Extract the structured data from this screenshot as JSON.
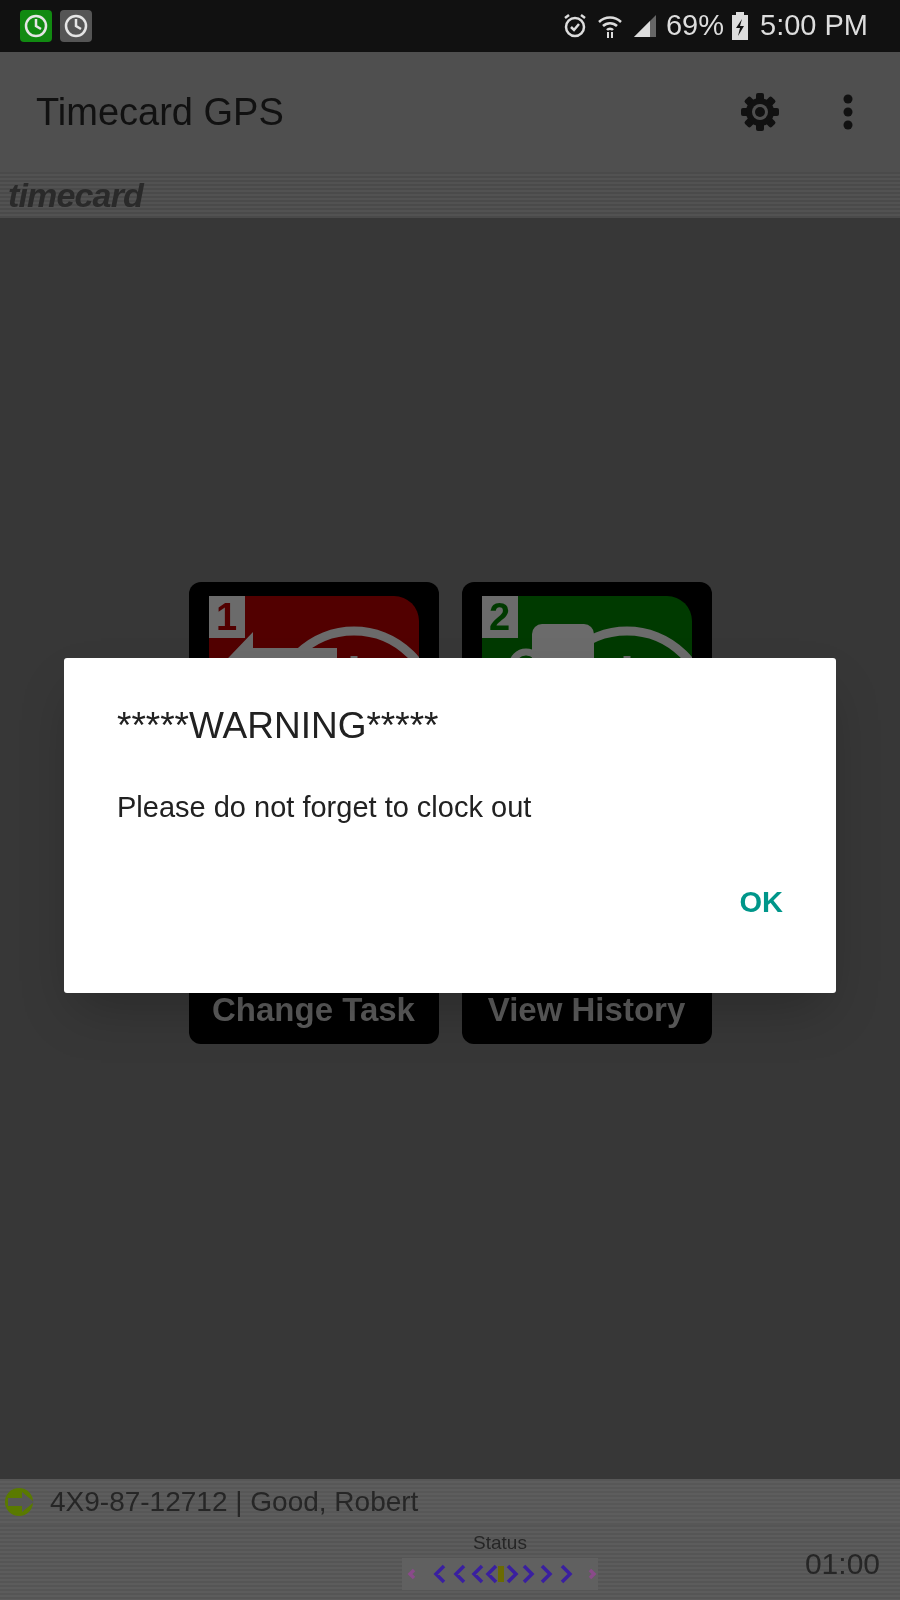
{
  "status_bar": {
    "battery": "69%",
    "time": "5:00 PM"
  },
  "app_bar": {
    "title": "Timecard GPS"
  },
  "logo": "timecard",
  "tiles": [
    {
      "number": "1",
      "label": "Change Task",
      "kind": "arrow",
      "color": "#520000"
    },
    {
      "number": "2",
      "label": "View History",
      "kind": "cup",
      "color": "#003a00"
    }
  ],
  "dialog": {
    "title": "*****WARNING*****",
    "message": "Please do not forget to clock out",
    "button": "OK"
  },
  "footer": {
    "employee": "4X9-87-12712 | Good, Robert",
    "status_label": "Status",
    "timer": "01:00"
  }
}
